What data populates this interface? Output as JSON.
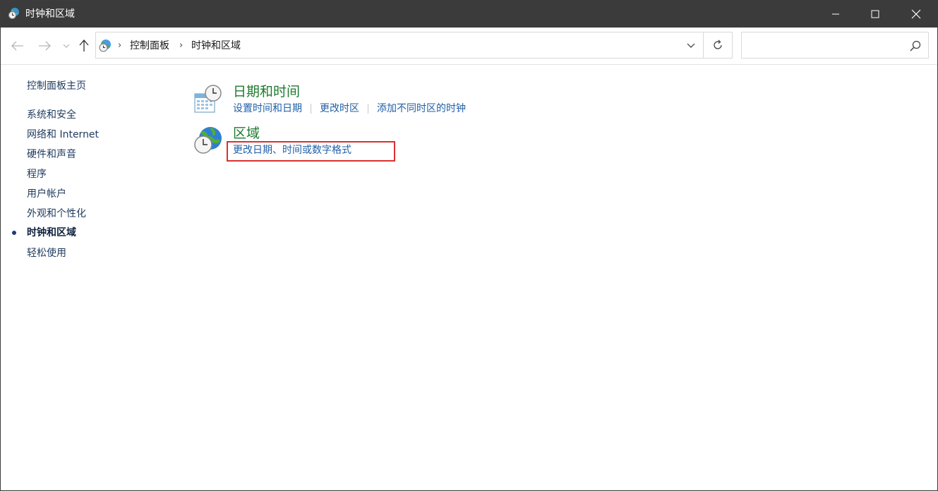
{
  "window": {
    "title": "时钟和区域",
    "title_icon": "clock-globe-icon",
    "controls": [
      "minimize-icon",
      "maximize-icon",
      "close-icon"
    ]
  },
  "navigation": {
    "back_icon": "back-arrow-icon",
    "forward_icon": "forward-arrow-icon",
    "recent_icon": "chevron-down-icon",
    "up_icon": "up-arrow-icon",
    "address": {
      "location_icon": "control-panel-icon",
      "breadcrumbs": [
        "控制面板",
        "时钟和区域"
      ],
      "dropdown_icon": "chevron-down-icon",
      "refresh_icon": "refresh-icon"
    },
    "search": {
      "value": "",
      "placeholder": "",
      "icon": "search-icon"
    }
  },
  "sidebar": {
    "home": "控制面板主页",
    "items": [
      {
        "label": "系统和安全",
        "current": false
      },
      {
        "label": "网络和 Internet",
        "current": false
      },
      {
        "label": "硬件和声音",
        "current": false
      },
      {
        "label": "程序",
        "current": false
      },
      {
        "label": "用户帐户",
        "current": false
      },
      {
        "label": "外观和个性化",
        "current": false
      },
      {
        "label": "时钟和区域",
        "current": true
      },
      {
        "label": "轻松使用",
        "current": false
      }
    ]
  },
  "main": {
    "categories": [
      {
        "title": "日期和时间",
        "icon": "calendar-clock-icon",
        "links": [
          "设置时间和日期",
          "更改时区",
          "添加不同时区的时钟"
        ]
      },
      {
        "title": "区域",
        "icon": "globe-clock-icon",
        "links": [
          "更改日期、时间或数字格式"
        ]
      }
    ]
  },
  "colors": {
    "titlebar": "#3b3b3b",
    "category_title": "#1d7a2d",
    "link": "#1f5fa8",
    "highlight": "#d93030"
  }
}
